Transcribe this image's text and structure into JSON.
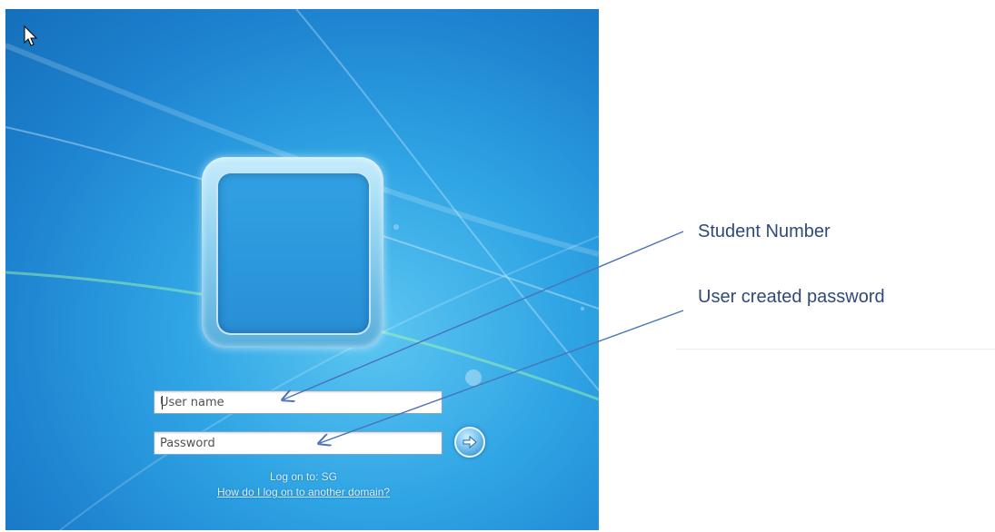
{
  "login": {
    "username_placeholder": "User name",
    "password_placeholder": "Password",
    "logon_to": "Log on to: SG",
    "domain_help_link": "How do I log on to another domain?"
  },
  "annotations": {
    "student_number": "Student Number",
    "user_password": "User created password"
  },
  "icons": {
    "cursor": "mouse-pointer-icon",
    "submit": "arrow-right-icon",
    "avatar": "user-picture-frame"
  },
  "colors": {
    "background_blue": "#2fa4e4",
    "annotation_text": "#2e4a7a",
    "annotation_line": "#4a72b8"
  }
}
